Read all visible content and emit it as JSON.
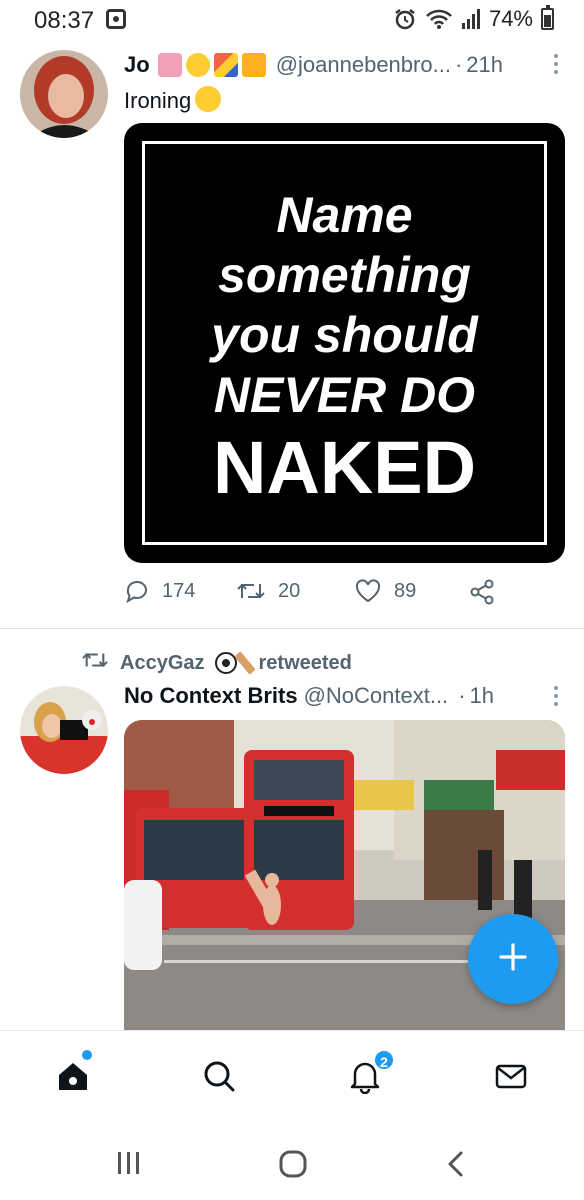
{
  "status_bar": {
    "time": "08:37",
    "battery": "74%"
  },
  "tweets": [
    {
      "name": "Jo",
      "name_emojis": [
        "birthday-cake",
        "partying-face",
        "party-popper",
        "wrapped-gift"
      ],
      "handle": "@joannebenbro...",
      "separator": "·",
      "time": "21h",
      "text": "Ironing",
      "text_emoji": "flushed-face",
      "image": {
        "lines": [
          "Name",
          "something",
          "you should",
          "NEVER DO"
        ],
        "big_line": "NAKED"
      },
      "actions": {
        "replies": "174",
        "retweets": "20",
        "likes": "89"
      }
    },
    {
      "retweeted_by": "AccyGaz",
      "retweeted_by_emojis": [
        "soccer-ball",
        "cricket-bat"
      ],
      "retweeted_label": "retweeted",
      "name": "No Context Brits",
      "handle": "@NoContext...",
      "separator": "·",
      "time": "1h"
    }
  ],
  "bottom_nav": {
    "items": [
      "home",
      "search",
      "notifications",
      "messages"
    ],
    "notifications_badge": "2"
  },
  "colors": {
    "accent": "#1d9bf0",
    "muted": "#536471",
    "text": "#0f1419"
  }
}
